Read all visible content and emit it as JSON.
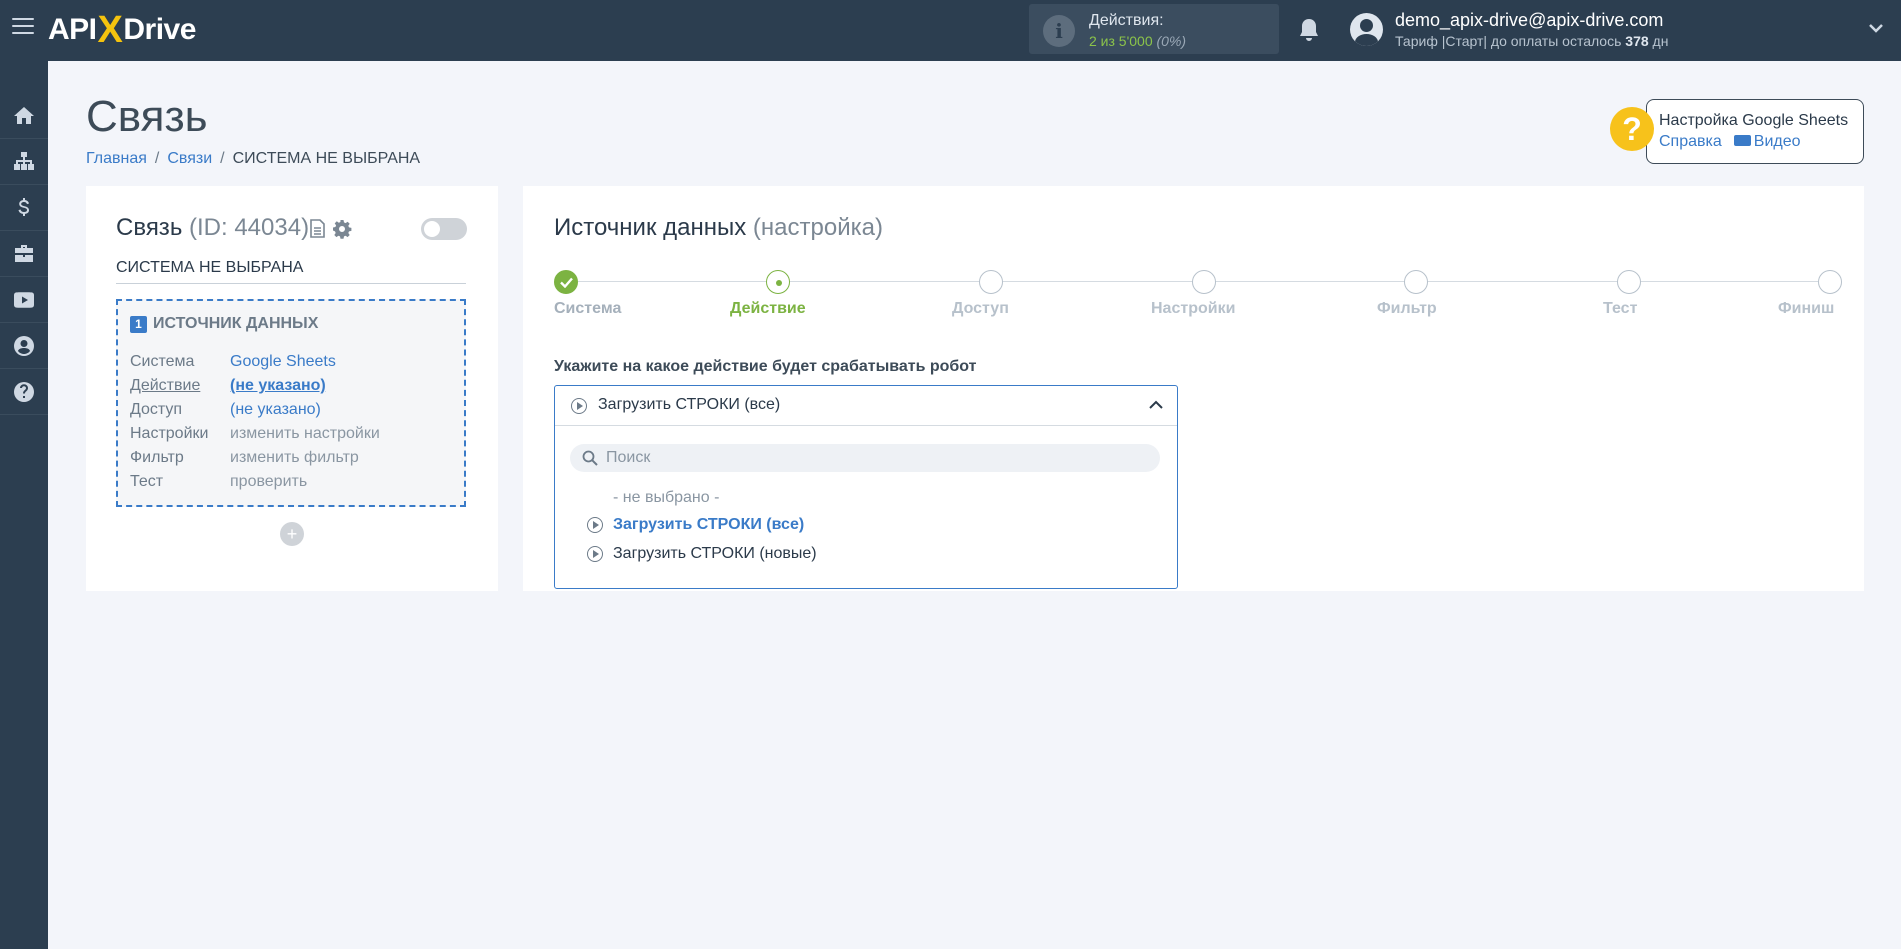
{
  "app": {
    "logo_left": "API",
    "logo_x": "X",
    "logo_right": "Drive"
  },
  "topbar": {
    "actions_label": "Действия:",
    "actions_value": "2 из 5'000",
    "actions_percent": "(0%)",
    "user_email": "demo_apix-drive@apix-drive.com",
    "user_plan_prefix": "Тариф |Старт| до оплаты осталось ",
    "user_plan_days": "378",
    "user_plan_suffix": " дн"
  },
  "sidebar": {
    "items": [
      {
        "icon": "home-icon"
      },
      {
        "icon": "sitemap-icon"
      },
      {
        "icon": "dollar-icon"
      },
      {
        "icon": "briefcase-icon"
      },
      {
        "icon": "youtube-icon"
      },
      {
        "icon": "user-icon"
      },
      {
        "icon": "help-icon"
      }
    ]
  },
  "page": {
    "title": "Связь",
    "breadcrumb": [
      "Главная",
      "Связи",
      "СИСТЕМА НЕ ВЫБРАНА"
    ]
  },
  "help": {
    "title": "Настройка Google Sheets",
    "link_help": "Справка",
    "link_video": "Видео"
  },
  "connection": {
    "title": "Связь",
    "id_text": "(ID: 44034)",
    "system_name": "СИСТЕМА НЕ ВЫБРАНА",
    "source_num": "1",
    "source_title": "ИСТОЧНИК ДАННЫХ",
    "rows": [
      {
        "k": "Система",
        "v": "Google Sheets"
      },
      {
        "k": "Действие",
        "v": "(не указано)"
      },
      {
        "k": "Доступ",
        "v": "(не указано)"
      },
      {
        "k": "Настройки",
        "v": "изменить настройки"
      },
      {
        "k": "Фильтр",
        "v": "изменить фильтр"
      },
      {
        "k": "Тест",
        "v": "проверить"
      }
    ],
    "add_label": "+"
  },
  "source": {
    "title": "Источник данных",
    "title_suffix": "(настройка)",
    "steps": [
      "Система",
      "Действие",
      "Доступ",
      "Настройки",
      "Фильтр",
      "Тест",
      "Финиш"
    ],
    "question": "Укажите на какое действие будет срабатывать робот",
    "selected": "Загрузить СТРОКИ (все)",
    "search_placeholder": "Поиск",
    "options": [
      "- не выбрано -",
      "Загрузить СТРОКИ (все)",
      "Загрузить СТРОКИ (новые)"
    ]
  },
  "colors": {
    "accent": "#3a7bc8",
    "success": "#7cb342",
    "topbar": "#2c3e50",
    "help": "#f7c21b"
  }
}
